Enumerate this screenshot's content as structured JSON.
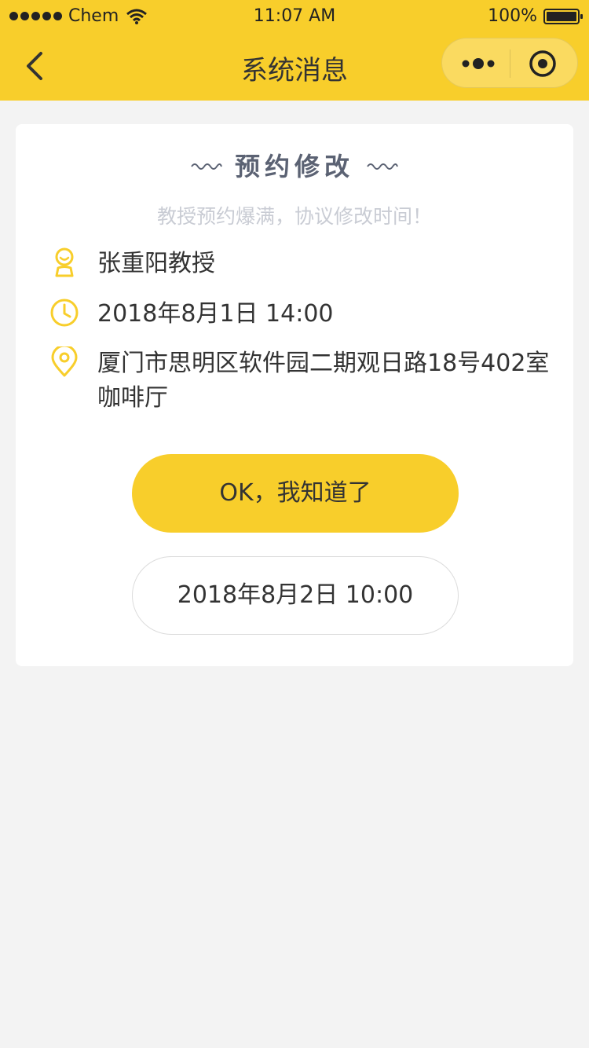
{
  "status_bar": {
    "carrier": "Chem",
    "time": "11:07 AM",
    "battery": "100%"
  },
  "nav": {
    "title": "系统消息"
  },
  "card": {
    "title": "预约修改",
    "subtitle": "教授预约爆满，协议修改时间！",
    "professor": "张重阳教授",
    "datetime": "2018年8月1日 14:00",
    "address": "厦门市思明区软件园二期观日路18号402室咖啡厅",
    "confirm_button": "OK，我知道了",
    "new_time_button": "2018年8月2日 10:00"
  },
  "colors": {
    "accent": "#f8ce2b",
    "background": "#f3f3f3",
    "title_gray": "#5b6273",
    "subtitle_gray": "#c9ccd4"
  },
  "icons": {
    "professor": "user-icon",
    "time": "clock-icon",
    "location": "location-pin-icon"
  }
}
